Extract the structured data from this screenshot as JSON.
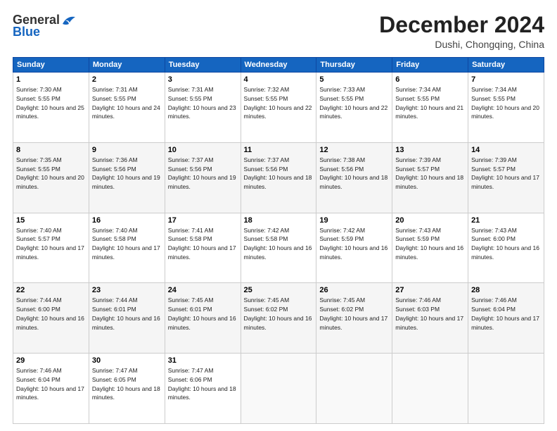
{
  "header": {
    "logo_general": "General",
    "logo_blue": "Blue",
    "month_title": "December 2024",
    "subtitle": "Dushi, Chongqing, China"
  },
  "days_of_week": [
    "Sunday",
    "Monday",
    "Tuesday",
    "Wednesday",
    "Thursday",
    "Friday",
    "Saturday"
  ],
  "weeks": [
    [
      {
        "day": 1,
        "sunrise": "7:30 AM",
        "sunset": "5:55 PM",
        "daylight": "10 hours and 25 minutes."
      },
      {
        "day": 2,
        "sunrise": "7:31 AM",
        "sunset": "5:55 PM",
        "daylight": "10 hours and 24 minutes."
      },
      {
        "day": 3,
        "sunrise": "7:31 AM",
        "sunset": "5:55 PM",
        "daylight": "10 hours and 23 minutes."
      },
      {
        "day": 4,
        "sunrise": "7:32 AM",
        "sunset": "5:55 PM",
        "daylight": "10 hours and 22 minutes."
      },
      {
        "day": 5,
        "sunrise": "7:33 AM",
        "sunset": "5:55 PM",
        "daylight": "10 hours and 22 minutes."
      },
      {
        "day": 6,
        "sunrise": "7:34 AM",
        "sunset": "5:55 PM",
        "daylight": "10 hours and 21 minutes."
      },
      {
        "day": 7,
        "sunrise": "7:34 AM",
        "sunset": "5:55 PM",
        "daylight": "10 hours and 20 minutes."
      }
    ],
    [
      {
        "day": 8,
        "sunrise": "7:35 AM",
        "sunset": "5:55 PM",
        "daylight": "10 hours and 20 minutes."
      },
      {
        "day": 9,
        "sunrise": "7:36 AM",
        "sunset": "5:56 PM",
        "daylight": "10 hours and 19 minutes."
      },
      {
        "day": 10,
        "sunrise": "7:37 AM",
        "sunset": "5:56 PM",
        "daylight": "10 hours and 19 minutes."
      },
      {
        "day": 11,
        "sunrise": "7:37 AM",
        "sunset": "5:56 PM",
        "daylight": "10 hours and 18 minutes."
      },
      {
        "day": 12,
        "sunrise": "7:38 AM",
        "sunset": "5:56 PM",
        "daylight": "10 hours and 18 minutes."
      },
      {
        "day": 13,
        "sunrise": "7:39 AM",
        "sunset": "5:57 PM",
        "daylight": "10 hours and 18 minutes."
      },
      {
        "day": 14,
        "sunrise": "7:39 AM",
        "sunset": "5:57 PM",
        "daylight": "10 hours and 17 minutes."
      }
    ],
    [
      {
        "day": 15,
        "sunrise": "7:40 AM",
        "sunset": "5:57 PM",
        "daylight": "10 hours and 17 minutes."
      },
      {
        "day": 16,
        "sunrise": "7:40 AM",
        "sunset": "5:58 PM",
        "daylight": "10 hours and 17 minutes."
      },
      {
        "day": 17,
        "sunrise": "7:41 AM",
        "sunset": "5:58 PM",
        "daylight": "10 hours and 17 minutes."
      },
      {
        "day": 18,
        "sunrise": "7:42 AM",
        "sunset": "5:58 PM",
        "daylight": "10 hours and 16 minutes."
      },
      {
        "day": 19,
        "sunrise": "7:42 AM",
        "sunset": "5:59 PM",
        "daylight": "10 hours and 16 minutes."
      },
      {
        "day": 20,
        "sunrise": "7:43 AM",
        "sunset": "5:59 PM",
        "daylight": "10 hours and 16 minutes."
      },
      {
        "day": 21,
        "sunrise": "7:43 AM",
        "sunset": "6:00 PM",
        "daylight": "10 hours and 16 minutes."
      }
    ],
    [
      {
        "day": 22,
        "sunrise": "7:44 AM",
        "sunset": "6:00 PM",
        "daylight": "10 hours and 16 minutes."
      },
      {
        "day": 23,
        "sunrise": "7:44 AM",
        "sunset": "6:01 PM",
        "daylight": "10 hours and 16 minutes."
      },
      {
        "day": 24,
        "sunrise": "7:45 AM",
        "sunset": "6:01 PM",
        "daylight": "10 hours and 16 minutes."
      },
      {
        "day": 25,
        "sunrise": "7:45 AM",
        "sunset": "6:02 PM",
        "daylight": "10 hours and 16 minutes."
      },
      {
        "day": 26,
        "sunrise": "7:45 AM",
        "sunset": "6:02 PM",
        "daylight": "10 hours and 17 minutes."
      },
      {
        "day": 27,
        "sunrise": "7:46 AM",
        "sunset": "6:03 PM",
        "daylight": "10 hours and 17 minutes."
      },
      {
        "day": 28,
        "sunrise": "7:46 AM",
        "sunset": "6:04 PM",
        "daylight": "10 hours and 17 minutes."
      }
    ],
    [
      {
        "day": 29,
        "sunrise": "7:46 AM",
        "sunset": "6:04 PM",
        "daylight": "10 hours and 17 minutes."
      },
      {
        "day": 30,
        "sunrise": "7:47 AM",
        "sunset": "6:05 PM",
        "daylight": "10 hours and 18 minutes."
      },
      {
        "day": 31,
        "sunrise": "7:47 AM",
        "sunset": "6:06 PM",
        "daylight": "10 hours and 18 minutes."
      },
      null,
      null,
      null,
      null
    ]
  ]
}
